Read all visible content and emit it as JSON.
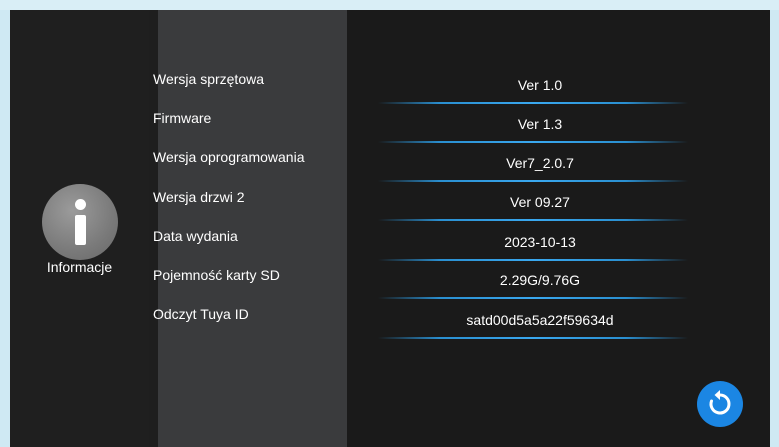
{
  "sidebar": {
    "icon": "info-icon",
    "label": "Informacje"
  },
  "info": {
    "rows": [
      {
        "label": "Wersja sprzętowa",
        "value": "Ver 1.0"
      },
      {
        "label": "Firmware",
        "value": "Ver 1.3"
      },
      {
        "label": "Wersja oprogramowania",
        "value": "Ver7_2.0.7"
      },
      {
        "label": "Wersja drzwi 2",
        "value": "Ver 09.27"
      },
      {
        "label": "Data wydania",
        "value": "2023-10-13"
      },
      {
        "label": "Pojemność karty SD",
        "value": "2.29G/9.76G"
      },
      {
        "label": "Odczyt Tuya ID",
        "value": "satd00d5a5a22f59634d"
      }
    ]
  },
  "actions": {
    "refresh_icon": "refresh-icon"
  },
  "colors": {
    "accent": "#1b86e3",
    "separator": "#3aa8ef"
  }
}
